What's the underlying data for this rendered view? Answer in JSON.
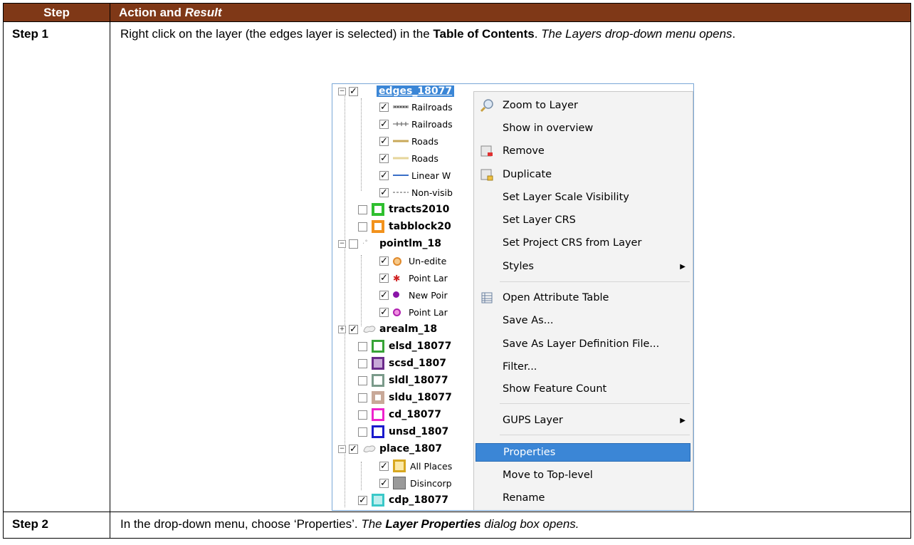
{
  "table": {
    "header_step": "Step",
    "header_action": "Action and ",
    "header_result": "Result"
  },
  "step1": {
    "label": "Step 1",
    "text_a": "Right click on the layer (the edges layer is selected) in the ",
    "text_bold": "Table of Contents",
    "text_b": ". ",
    "text_result": "The Layers drop-down menu opens",
    "text_end": "."
  },
  "step2": {
    "label": "Step 2",
    "text_a": "In the drop-down menu, choose ‘Properties’. ",
    "text_italic": "The ",
    "text_bolditalic": "Layer Properties",
    "text_italic2": " dialog box opens."
  },
  "toc": {
    "edges": "edges_18077",
    "sub1": "Railroads",
    "sub2": "Railroads",
    "sub3": "Roads",
    "sub4": "Roads",
    "sub5": "Linear W",
    "sub6": "Non-visib",
    "tracts": "tracts2010",
    "tabblock": "tabblock20",
    "pointlm": "pointlm_18",
    "p1": "Un-edite",
    "p2": "Point Lar",
    "p3": "New Poir",
    "p4": "Point Lar",
    "arealm": "arealm_18",
    "elsd": "elsd_18077",
    "scsd": "scsd_1807",
    "sldl": "sldl_18077",
    "sldu": "sldu_18077",
    "cd": "cd_18077",
    "unsd": "unsd_1807",
    "place": "place_1807",
    "pl1": "All Places",
    "pl2": "Disincorp",
    "cdp": "cdp_18077"
  },
  "menu": {
    "zoom": "Zoom to Layer",
    "overview": "Show in overview",
    "remove": "Remove",
    "duplicate": "Duplicate",
    "scalevis": "Set Layer Scale Visibility",
    "crs": "Set Layer CRS",
    "projcrs": "Set Project CRS from Layer",
    "styles": "Styles",
    "attr": "Open Attribute Table",
    "saveas": "Save As...",
    "savedef": "Save As Layer Definition File...",
    "filter": "Filter...",
    "count": "Show Feature Count",
    "gups": "GUPS Layer",
    "properties": "Properties",
    "movetop": "Move to Top-level",
    "rename": "Rename"
  },
  "colors": {
    "header_bg": "#7f3817",
    "highlight": "#3b86d6"
  }
}
